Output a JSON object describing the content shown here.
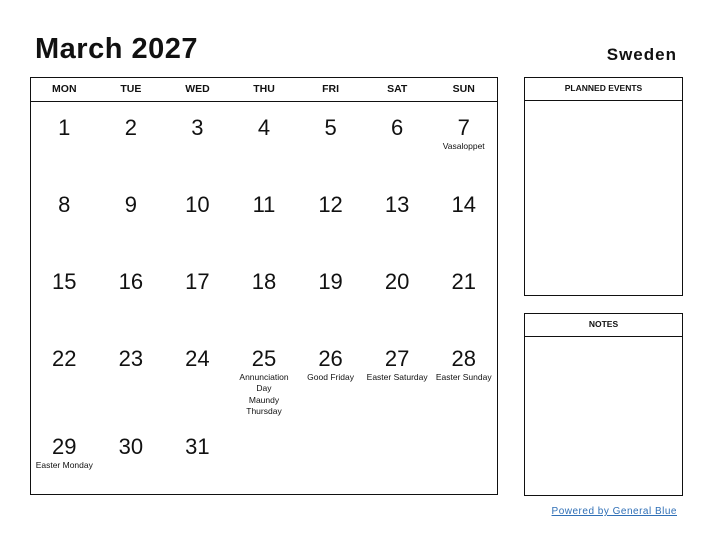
{
  "header": {
    "title": "March 2027",
    "country": "Sweden"
  },
  "weekdays": [
    "MON",
    "TUE",
    "WED",
    "THU",
    "FRI",
    "SAT",
    "SUN"
  ],
  "weeks": [
    [
      {
        "day": "1"
      },
      {
        "day": "2"
      },
      {
        "day": "3"
      },
      {
        "day": "4"
      },
      {
        "day": "5"
      },
      {
        "day": "6"
      },
      {
        "day": "7",
        "events": [
          "Vasaloppet"
        ]
      }
    ],
    [
      {
        "day": "8"
      },
      {
        "day": "9"
      },
      {
        "day": "10"
      },
      {
        "day": "11"
      },
      {
        "day": "12"
      },
      {
        "day": "13"
      },
      {
        "day": "14"
      }
    ],
    [
      {
        "day": "15"
      },
      {
        "day": "16"
      },
      {
        "day": "17"
      },
      {
        "day": "18"
      },
      {
        "day": "19"
      },
      {
        "day": "20"
      },
      {
        "day": "21"
      }
    ],
    [
      {
        "day": "22"
      },
      {
        "day": "23"
      },
      {
        "day": "24"
      },
      {
        "day": "25",
        "events": [
          "Annunciation Day",
          "Maundy Thursday"
        ]
      },
      {
        "day": "26",
        "events": [
          "Good Friday"
        ]
      },
      {
        "day": "27",
        "events": [
          "Easter Saturday"
        ]
      },
      {
        "day": "28",
        "events": [
          "Easter Sunday"
        ]
      }
    ],
    [
      {
        "day": "29",
        "events": [
          "Easter Monday"
        ]
      },
      {
        "day": "30"
      },
      {
        "day": "31"
      },
      {
        "day": ""
      },
      {
        "day": ""
      },
      {
        "day": ""
      },
      {
        "day": ""
      }
    ]
  ],
  "panels": {
    "planned_events": "PLANNED EVENTS",
    "notes": "NOTES"
  },
  "footer": {
    "link": "Powered by General Blue"
  }
}
